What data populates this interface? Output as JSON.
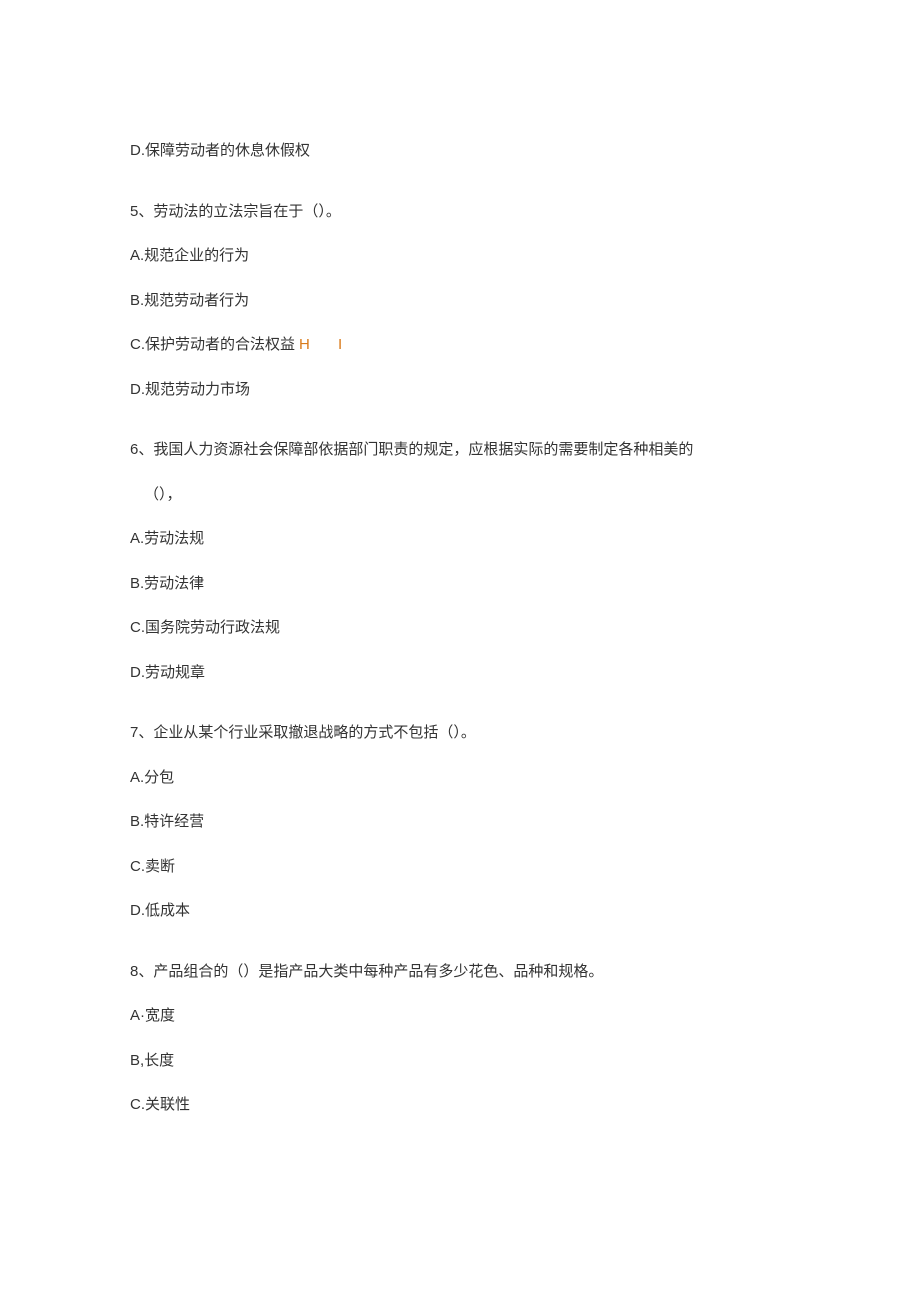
{
  "q4_optionD": "D.保障劳动者的休息休假权",
  "q5": {
    "stem": "5、劳动法的立法宗旨在于（）。",
    "optionA": "A.规范企业的行为",
    "optionB": "B.规范劳动者行为",
    "optionC": "C.保护劳动者的合法权益",
    "optionC_marks": "H I",
    "optionD": "D.规范劳动力市场"
  },
  "q6": {
    "stem_line1": "6、我国人力资源社会保障部依据部门职责的规定，应根据实际的需要制定各种相美的",
    "stem_line2": "（），",
    "optionA": "A.劳动法规",
    "optionB": "B.劳动法律",
    "optionC": "C.国务院劳动行政法规",
    "optionD": "D.劳动规章"
  },
  "q7": {
    "stem": "7、企业从某个行业采取撤退战略的方式不包括（）。",
    "optionA": "A.分包",
    "optionB": "B.特许经营",
    "optionC": "C.卖断",
    "optionD": "D.低成本"
  },
  "q8": {
    "stem": "8、产品组合的（）是指产品大类中每种产品有多少花色、品种和规格。",
    "optionA": "A·宽度",
    "optionB": "B,长度",
    "optionC": "C.关联性"
  }
}
